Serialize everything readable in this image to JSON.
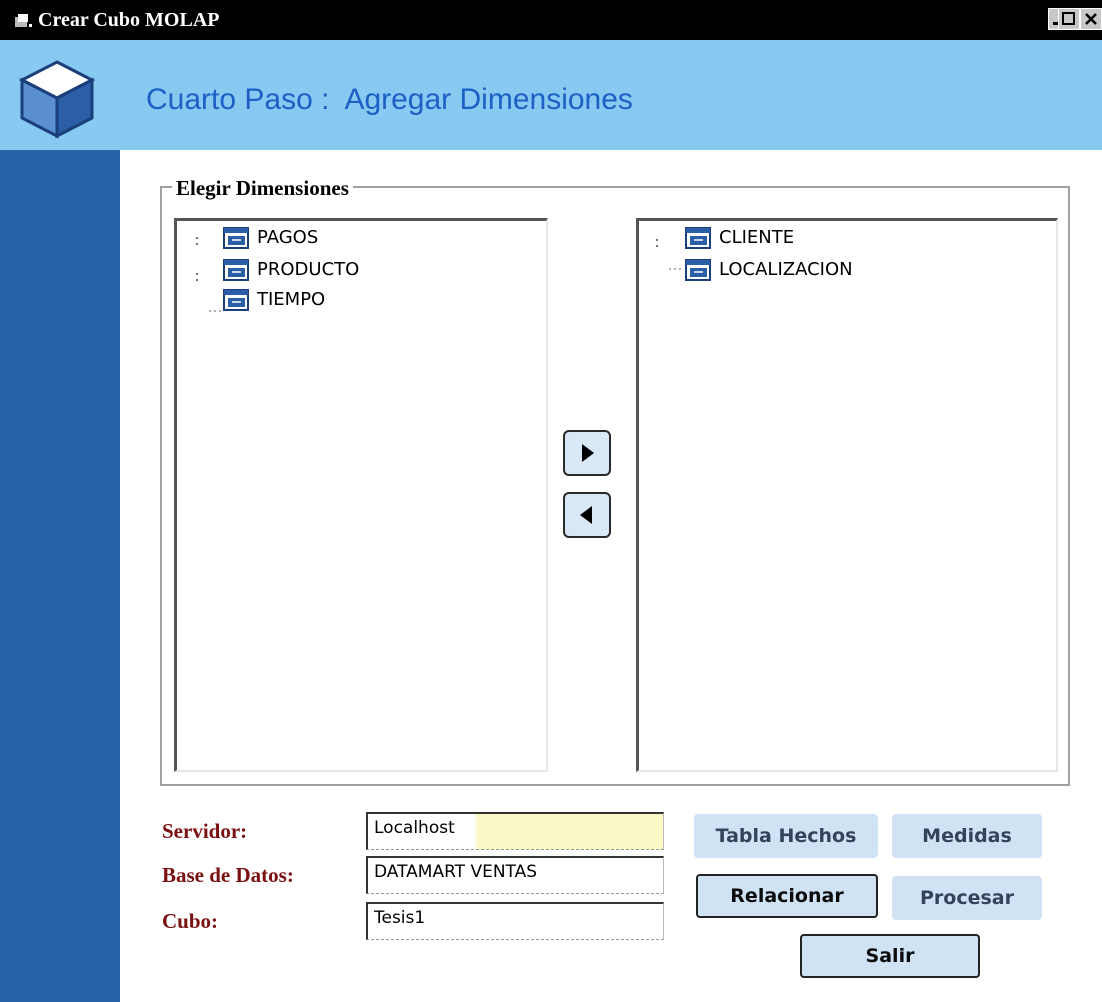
{
  "window": {
    "title": "Crear Cubo MOLAP"
  },
  "header": {
    "title": "Cuarto Paso :  Agregar Dimensiones"
  },
  "groupbox": {
    "legend": "Elegir Dimensiones"
  },
  "available_dimensions": [
    {
      "label": "PAGOS",
      "icon": "table-icon"
    },
    {
      "label": "PRODUCTO",
      "icon": "table-icon"
    },
    {
      "label": "TIEMPO",
      "icon": "table-icon"
    }
  ],
  "selected_dimensions": [
    {
      "label": "CLIENTE",
      "icon": "table-icon"
    },
    {
      "label": "LOCALIZACION",
      "icon": "table-icon"
    }
  ],
  "form": {
    "servidor_label": "Servidor:",
    "servidor_value": "Localhost",
    "base_datos_label": "Base de Datos:",
    "base_datos_value": "DATAMART VENTAS",
    "cubo_label": "Cubo:",
    "cubo_value": "Tesis1"
  },
  "buttons": {
    "tabla_hechos": "Tabla Hechos",
    "medidas": "Medidas",
    "relacionar": "Relacionar",
    "procesar": "Procesar",
    "salir": "Salir"
  },
  "colors": {
    "header_bg": "#88c9f2",
    "sidebar_bg": "#2663a6",
    "title_color": "#1d5fc4",
    "label_color": "#7a1010",
    "button_bg": "#cfe3f5"
  }
}
